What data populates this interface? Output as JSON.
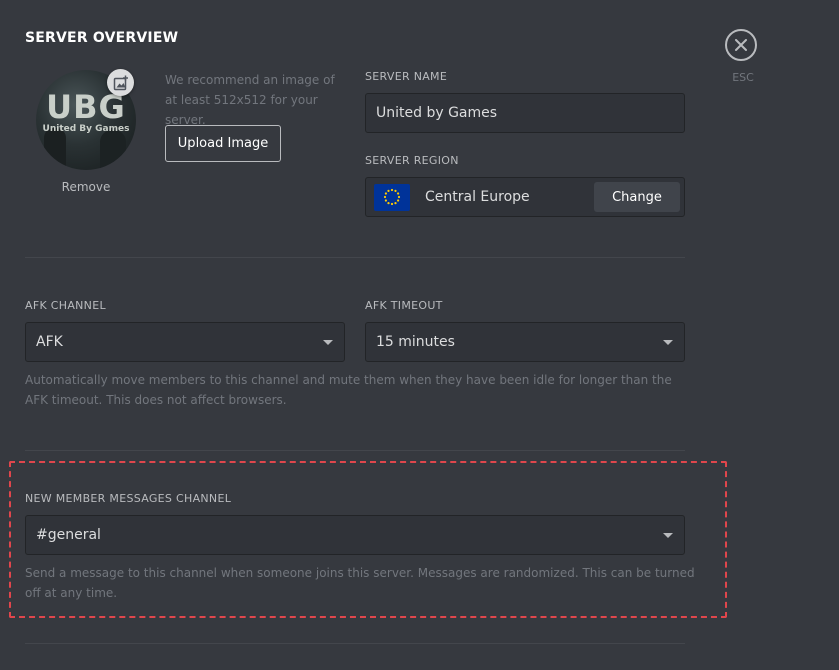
{
  "header": {
    "title": "SERVER OVERVIEW"
  },
  "close": {
    "icon": "close-icon",
    "esc_label": "ESC"
  },
  "avatar": {
    "logo_text": "UBG",
    "logo_subtext": "United By Games",
    "add_icon": "add-image-icon",
    "remove_label": "Remove"
  },
  "upload": {
    "hint": "We recommend an image of at least 512x512 for your server.",
    "button_label": "Upload Image"
  },
  "server_name": {
    "label": "SERVER NAME",
    "value": "United by Games"
  },
  "server_region": {
    "label": "SERVER REGION",
    "flag_icon": "eu-flag-icon",
    "value": "Central Europe",
    "change_label": "Change"
  },
  "afk_channel": {
    "label": "AFK CHANNEL",
    "value": "AFK"
  },
  "afk_timeout": {
    "label": "AFK TIMEOUT",
    "value": "15 minutes"
  },
  "afk_description": "Automatically move members to this channel and mute them when they have been idle for longer than the AFK timeout. This does not affect browsers.",
  "new_member": {
    "label": "NEW MEMBER MESSAGES CHANNEL",
    "value": "#general",
    "description": "Send a message to this channel when someone joins this server. Messages are randomized. This can be turned off at any time."
  },
  "colors": {
    "background": "#36393f",
    "input_bg": "#303339",
    "highlight": "#e0464c",
    "eu_blue": "#003399",
    "eu_star": "#ffcc00"
  }
}
